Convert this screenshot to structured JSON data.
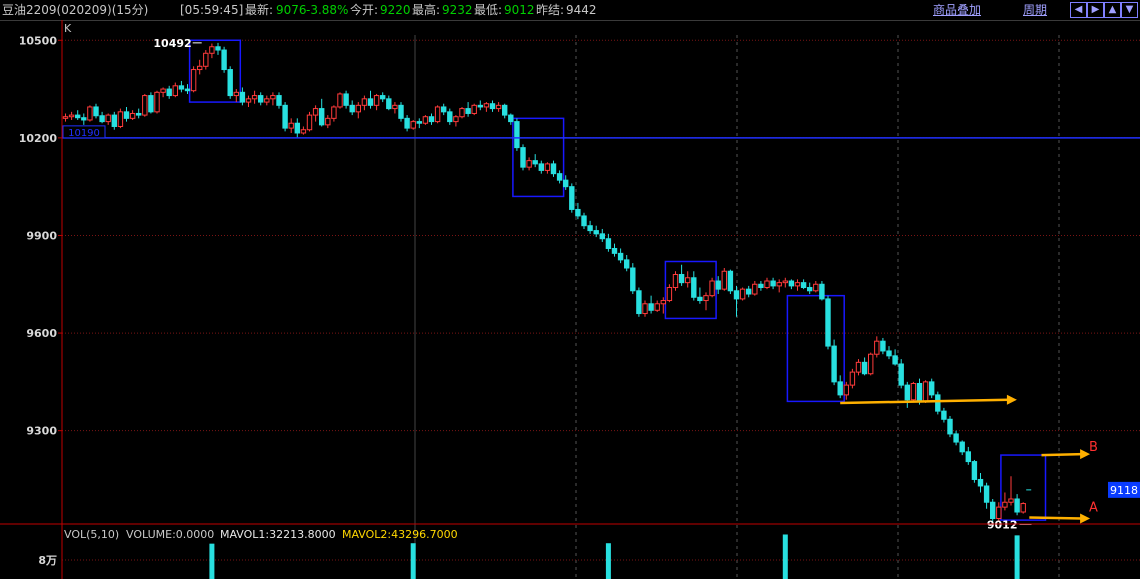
{
  "header": {
    "symbol": "豆油2209(020209)(15分)",
    "time": "[05:59:45]",
    "last_label": "最新:",
    "last": "9076",
    "change": "-3.88%",
    "open_label": "今开:",
    "open": "9220",
    "high_label": "最高:",
    "high": "9232",
    "low_label": "最低:",
    "low": "9012",
    "prev_label": "昨结:",
    "prev": "9442",
    "overlay_link": "商品叠加",
    "period_link": "周期",
    "nav_icons": [
      "arrow-left-icon",
      "arrow-right-icon",
      "arrow-up-icon",
      "arrow-down-icon"
    ]
  },
  "colors": {
    "up": "#ff3b3b",
    "down": "#28e0e0",
    "box": "#1818ff",
    "hline": "#2030ff",
    "arrow": "#ffb000",
    "grid": "#7a1414",
    "axis": "#c00000"
  },
  "chart_data": {
    "type": "candlestick",
    "panel_label": "K",
    "ylim": [
      9050,
      10550
    ],
    "yticks": [
      10500,
      10200,
      9900,
      9600,
      9300
    ],
    "hline": {
      "value": 10200,
      "label": "10190"
    },
    "current_price": "9118",
    "annotations": [
      {
        "text": "10492",
        "bar": 22,
        "value": 10492
      },
      {
        "text": "9012",
        "bar": 160,
        "value": 9012
      },
      {
        "text": "B",
        "value": 9225
      },
      {
        "text": "A",
        "value": 9045
      }
    ],
    "boxes": [
      {
        "from": 21,
        "to": 28,
        "high": 10500,
        "low": 10310
      },
      {
        "from": 74,
        "to": 81,
        "high": 10260,
        "low": 10020
      },
      {
        "from": 99,
        "to": 106,
        "high": 9820,
        "low": 9645
      },
      {
        "from": 119,
        "to": 127,
        "high": 9715,
        "low": 9390
      },
      {
        "from": 154,
        "to": 160,
        "high": 9225,
        "low": 9025
      }
    ],
    "arrows": [
      {
        "from_bar": 127,
        "to_bar": 154,
        "y_start": 9385,
        "y_end": 9395
      },
      {
        "from_bar": 160,
        "to_bar": 166,
        "y_start": 9225,
        "y_end": 9228
      },
      {
        "from_bar": 158,
        "to_bar": 166,
        "y_start": 9033,
        "y_end": 9030
      }
    ],
    "candles": [
      [
        10260,
        10275,
        10250,
        10265
      ],
      [
        10265,
        10280,
        10255,
        10270
      ],
      [
        10270,
        10285,
        10255,
        10262
      ],
      [
        10262,
        10275,
        10240,
        10255
      ],
      [
        10255,
        10300,
        10250,
        10295
      ],
      [
        10295,
        10305,
        10260,
        10268
      ],
      [
        10268,
        10280,
        10245,
        10250
      ],
      [
        10250,
        10275,
        10240,
        10270
      ],
      [
        10270,
        10280,
        10225,
        10235
      ],
      [
        10235,
        10290,
        10230,
        10280
      ],
      [
        10280,
        10295,
        10250,
        10260
      ],
      [
        10260,
        10285,
        10255,
        10275
      ],
      [
        10275,
        10290,
        10260,
        10270
      ],
      [
        10270,
        10335,
        10265,
        10330
      ],
      [
        10330,
        10340,
        10275,
        10280
      ],
      [
        10280,
        10345,
        10275,
        10340
      ],
      [
        10340,
        10355,
        10325,
        10350
      ],
      [
        10350,
        10360,
        10320,
        10330
      ],
      [
        10330,
        10370,
        10325,
        10360
      ],
      [
        10360,
        10375,
        10340,
        10350
      ],
      [
        10350,
        10365,
        10335,
        10345
      ],
      [
        10345,
        10420,
        10340,
        10410
      ],
      [
        10410,
        10440,
        10395,
        10420
      ],
      [
        10420,
        10470,
        10410,
        10460
      ],
      [
        10460,
        10490,
        10445,
        10480
      ],
      [
        10480,
        10492,
        10455,
        10470
      ],
      [
        10470,
        10480,
        10400,
        10410
      ],
      [
        10410,
        10420,
        10320,
        10330
      ],
      [
        10330,
        10350,
        10310,
        10340
      ],
      [
        10340,
        10355,
        10300,
        10310
      ],
      [
        10310,
        10330,
        10295,
        10320
      ],
      [
        10320,
        10345,
        10305,
        10330
      ],
      [
        10330,
        10340,
        10300,
        10310
      ],
      [
        10310,
        10330,
        10300,
        10320
      ],
      [
        10320,
        10340,
        10300,
        10330
      ],
      [
        10330,
        10340,
        10290,
        10300
      ],
      [
        10300,
        10310,
        10220,
        10230
      ],
      [
        10230,
        10260,
        10215,
        10245
      ],
      [
        10245,
        10260,
        10200,
        10215
      ],
      [
        10215,
        10235,
        10210,
        10225
      ],
      [
        10225,
        10280,
        10220,
        10270
      ],
      [
        10270,
        10300,
        10250,
        10290
      ],
      [
        10290,
        10320,
        10235,
        10240
      ],
      [
        10240,
        10270,
        10230,
        10260
      ],
      [
        10260,
        10300,
        10250,
        10295
      ],
      [
        10295,
        10340,
        10290,
        10335
      ],
      [
        10335,
        10345,
        10290,
        10300
      ],
      [
        10300,
        10315,
        10270,
        10280
      ],
      [
        10280,
        10310,
        10260,
        10300
      ],
      [
        10300,
        10330,
        10285,
        10320
      ],
      [
        10320,
        10345,
        10290,
        10300
      ],
      [
        10300,
        10335,
        10285,
        10330
      ],
      [
        10330,
        10340,
        10310,
        10320
      ],
      [
        10320,
        10330,
        10285,
        10290
      ],
      [
        10290,
        10310,
        10275,
        10300
      ],
      [
        10300,
        10310,
        10250,
        10260
      ],
      [
        10260,
        10270,
        10220,
        10230
      ],
      [
        10230,
        10255,
        10225,
        10250
      ],
      [
        10250,
        10260,
        10230,
        10245
      ],
      [
        10245,
        10270,
        10240,
        10265
      ],
      [
        10265,
        10275,
        10240,
        10250
      ],
      [
        10250,
        10300,
        10245,
        10295
      ],
      [
        10295,
        10305,
        10270,
        10280
      ],
      [
        10280,
        10290,
        10240,
        10250
      ],
      [
        10250,
        10270,
        10235,
        10265
      ],
      [
        10265,
        10295,
        10260,
        10290
      ],
      [
        10290,
        10310,
        10265,
        10275
      ],
      [
        10275,
        10305,
        10270,
        10300
      ],
      [
        10300,
        10315,
        10285,
        10295
      ],
      [
        10295,
        10310,
        10280,
        10305
      ],
      [
        10305,
        10315,
        10280,
        10290
      ],
      [
        10290,
        10310,
        10280,
        10300
      ],
      [
        10300,
        10305,
        10260,
        10270
      ],
      [
        10270,
        10275,
        10240,
        10250
      ],
      [
        10250,
        10260,
        10160,
        10170
      ],
      [
        10170,
        10180,
        10100,
        10110
      ],
      [
        10110,
        10140,
        10100,
        10130
      ],
      [
        10130,
        10150,
        10110,
        10120
      ],
      [
        10120,
        10130,
        10090,
        10100
      ],
      [
        10100,
        10125,
        10090,
        10120
      ],
      [
        10120,
        10130,
        10080,
        10090
      ],
      [
        10090,
        10100,
        10060,
        10070
      ],
      [
        10070,
        10085,
        10040,
        10050
      ],
      [
        10050,
        10060,
        9970,
        9980
      ],
      [
        9980,
        10000,
        9950,
        9960
      ],
      [
        9960,
        9970,
        9920,
        9930
      ],
      [
        9930,
        9945,
        9905,
        9915
      ],
      [
        9915,
        9930,
        9895,
        9905
      ],
      [
        9905,
        9920,
        9880,
        9890
      ],
      [
        9890,
        9905,
        9850,
        9860
      ],
      [
        9860,
        9875,
        9835,
        9845
      ],
      [
        9845,
        9860,
        9815,
        9825
      ],
      [
        9825,
        9840,
        9790,
        9800
      ],
      [
        9800,
        9815,
        9720,
        9730
      ],
      [
        9730,
        9740,
        9650,
        9660
      ],
      [
        9660,
        9700,
        9650,
        9690
      ],
      [
        9690,
        9715,
        9660,
        9670
      ],
      [
        9670,
        9700,
        9665,
        9690
      ],
      [
        9690,
        9710,
        9660,
        9700
      ],
      [
        9700,
        9750,
        9695,
        9740
      ],
      [
        9740,
        9790,
        9730,
        9780
      ],
      [
        9780,
        9810,
        9745,
        9755
      ],
      [
        9755,
        9790,
        9740,
        9770
      ],
      [
        9770,
        9790,
        9700,
        9710
      ],
      [
        9710,
        9740,
        9690,
        9700
      ],
      [
        9700,
        9725,
        9670,
        9715
      ],
      [
        9715,
        9770,
        9710,
        9760
      ],
      [
        9760,
        9775,
        9720,
        9735
      ],
      [
        9735,
        9800,
        9730,
        9790
      ],
      [
        9790,
        9795,
        9720,
        9730
      ],
      [
        9730,
        9745,
        9650,
        9705
      ],
      [
        9705,
        9740,
        9700,
        9735
      ],
      [
        9735,
        9745,
        9710,
        9720
      ],
      [
        9720,
        9760,
        9715,
        9750
      ],
      [
        9750,
        9760,
        9730,
        9740
      ],
      [
        9740,
        9770,
        9735,
        9760
      ],
      [
        9760,
        9770,
        9735,
        9745
      ],
      [
        9745,
        9765,
        9725,
        9755
      ],
      [
        9755,
        9770,
        9740,
        9760
      ],
      [
        9760,
        9765,
        9735,
        9745
      ],
      [
        9745,
        9765,
        9730,
        9755
      ],
      [
        9755,
        9765,
        9735,
        9740
      ],
      [
        9740,
        9755,
        9720,
        9730
      ],
      [
        9730,
        9760,
        9725,
        9750
      ],
      [
        9750,
        9760,
        9700,
        9705
      ],
      [
        9705,
        9715,
        9550,
        9560
      ],
      [
        9560,
        9580,
        9440,
        9450
      ],
      [
        9450,
        9470,
        9400,
        9410
      ],
      [
        9410,
        9450,
        9395,
        9440
      ],
      [
        9440,
        9490,
        9430,
        9480
      ],
      [
        9480,
        9520,
        9470,
        9510
      ],
      [
        9510,
        9525,
        9470,
        9475
      ],
      [
        9475,
        9540,
        9470,
        9535
      ],
      [
        9535,
        9590,
        9525,
        9575
      ],
      [
        9575,
        9585,
        9535,
        9545
      ],
      [
        9545,
        9560,
        9520,
        9530
      ],
      [
        9530,
        9550,
        9500,
        9505
      ],
      [
        9505,
        9520,
        9430,
        9440
      ],
      [
        9440,
        9450,
        9370,
        9395
      ],
      [
        9395,
        9450,
        9390,
        9445
      ],
      [
        9445,
        9460,
        9380,
        9390
      ],
      [
        9390,
        9455,
        9385,
        9450
      ],
      [
        9450,
        9460,
        9400,
        9410
      ],
      [
        9410,
        9420,
        9350,
        9360
      ],
      [
        9360,
        9370,
        9325,
        9335
      ],
      [
        9335,
        9345,
        9280,
        9290
      ],
      [
        9290,
        9300,
        9255,
        9265
      ],
      [
        9265,
        9270,
        9225,
        9235
      ],
      [
        9235,
        9250,
        9195,
        9205
      ],
      [
        9205,
        9210,
        9140,
        9150
      ],
      [
        9150,
        9170,
        9110,
        9130
      ],
      [
        9130,
        9140,
        9060,
        9080
      ],
      [
        9080,
        9090,
        9012,
        9030
      ],
      [
        9030,
        9080,
        9020,
        9065
      ],
      [
        9065,
        9110,
        9055,
        9080
      ],
      [
        9080,
        9160,
        9070,
        9090
      ],
      [
        9090,
        9105,
        9040,
        9050
      ],
      [
        9050,
        9080,
        9045,
        9076
      ]
    ],
    "volume": {
      "label": "VOL(5,10)",
      "volume": "VOLUME:0.0000",
      "mavol1": "MAVOL1:32213.8000",
      "mavol2": "MAVOL2:43296.7000",
      "ytick": "8万",
      "spikes": [
        {
          "bar": 118,
          "value": 102000
        },
        {
          "bar": 156,
          "value": 100000
        },
        {
          "bar": 57,
          "value": 82000
        },
        {
          "bar": 89,
          "value": 82000
        },
        {
          "bar": 24,
          "value": 81000
        }
      ],
      "ylim": [
        0,
        110000
      ]
    }
  }
}
